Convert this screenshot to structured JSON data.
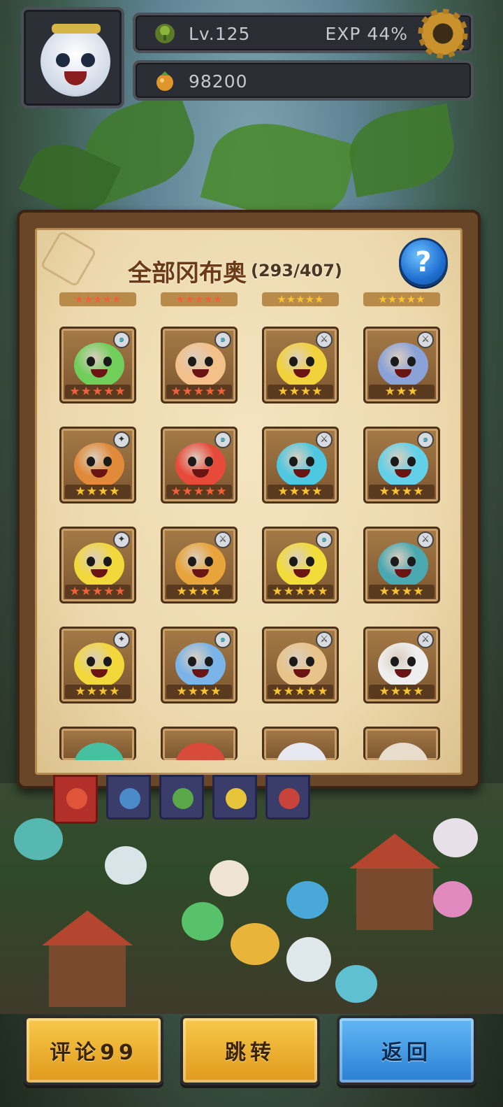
{
  "hud": {
    "level": "Lv.125",
    "exp": "EXP 44%",
    "coins": "98200",
    "level_icon": "leaf-badge-icon",
    "coin_icon": "fruit-coin-icon",
    "settings_icon": "gear-icon"
  },
  "panel": {
    "title": "全部冈布奥",
    "count": "(293/407)",
    "help_label": "?"
  },
  "cards": [
    {
      "stars": "★★★★★",
      "star_color": "red",
      "class": "water",
      "art": "#6fcf5a"
    },
    {
      "stars": "★★★★★",
      "star_color": "red",
      "class": "water",
      "art": "#f3c08a"
    },
    {
      "stars": "★★★★",
      "star_color": "gold",
      "class": "sword",
      "art": "#f2d23a"
    },
    {
      "stars": "★★★",
      "star_color": "gold",
      "class": "sword",
      "art": "#8aa2d8"
    },
    {
      "stars": "★★★★",
      "star_color": "gold",
      "class": "mage",
      "art": "#e08a3a"
    },
    {
      "stars": "★★★★★",
      "star_color": "red",
      "class": "water",
      "art": "#e84a3a"
    },
    {
      "stars": "★★★★",
      "star_color": "gold",
      "class": "sword",
      "art": "#4ec8e0"
    },
    {
      "stars": "★★★★",
      "star_color": "gold",
      "class": "water",
      "art": "#62d0e8"
    },
    {
      "stars": "★★★★★",
      "star_color": "red",
      "class": "mage",
      "art": "#f2d83a"
    },
    {
      "stars": "★★★★",
      "star_color": "gold",
      "class": "sword",
      "art": "#e8a43a"
    },
    {
      "stars": "★★★★★",
      "star_color": "gold",
      "class": "water",
      "art": "#f2dc3a"
    },
    {
      "stars": "★★★★",
      "star_color": "gold",
      "class": "sword",
      "art": "#4aa8b0"
    },
    {
      "stars": "★★★★",
      "star_color": "gold",
      "class": "mage",
      "art": "#f2d83a"
    },
    {
      "stars": "★★★★",
      "star_color": "gold",
      "class": "water",
      "art": "#7ab4e8"
    },
    {
      "stars": "★★★★★",
      "star_color": "gold",
      "class": "sword",
      "art": "#e8c48a"
    },
    {
      "stars": "★★★★",
      "star_color": "gold",
      "class": "sword",
      "art": "#eeeeee"
    }
  ],
  "tabs": [
    {
      "name": "tab-all",
      "icon": "group-icon",
      "color": "#e0553a"
    },
    {
      "name": "tab-water",
      "icon": "water-gumball-icon",
      "color": "#4a8ac8"
    },
    {
      "name": "tab-nature",
      "icon": "nature-gumball-icon",
      "color": "#5aa84a"
    },
    {
      "name": "tab-light",
      "icon": "light-gumball-icon",
      "color": "#e8c43a"
    },
    {
      "name": "tab-fire",
      "icon": "fire-gumball-icon",
      "color": "#c8443a"
    }
  ],
  "buttons": {
    "comment": "评论99",
    "jump": "跳转",
    "back": "返回"
  }
}
